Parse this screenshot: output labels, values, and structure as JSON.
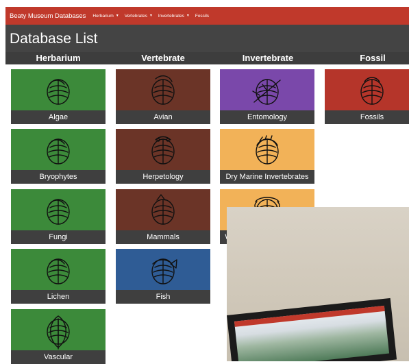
{
  "nav": {
    "brand": "Beaty Museum Databases",
    "items": [
      {
        "label": "Herbarium",
        "has_dropdown": true
      },
      {
        "label": "Vertebrates",
        "has_dropdown": true
      },
      {
        "label": "Invertebrates",
        "has_dropdown": true
      },
      {
        "label": "Fossils",
        "has_dropdown": false
      }
    ]
  },
  "page": {
    "title": "Database List"
  },
  "columns": [
    "Herbarium",
    "Vertebrate",
    "Invertebrate",
    "Fossil"
  ],
  "tiles": [
    {
      "label": "Algae",
      "column": "Herbarium",
      "color": "#3c8a3a",
      "icon": "leaf-on-turtle-icon"
    },
    {
      "label": "Bryophytes",
      "column": "Herbarium",
      "color": "#3c8a3a",
      "icon": "leaf-on-turtle-icon"
    },
    {
      "label": "Fungi",
      "column": "Herbarium",
      "color": "#3c8a3a",
      "icon": "leaf-on-turtle-icon"
    },
    {
      "label": "Lichen",
      "column": "Herbarium",
      "color": "#3c8a3a",
      "icon": "leaf-on-turtle-icon"
    },
    {
      "label": "Vascular",
      "column": "Herbarium",
      "color": "#3c8a3a",
      "icon": "leaf-icon"
    },
    {
      "label": "Avian",
      "column": "Vertebrate",
      "color": "#6b3427",
      "icon": "bird-icon"
    },
    {
      "label": "Herpetology",
      "column": "Vertebrate",
      "color": "#6b3427",
      "icon": "frog-icon"
    },
    {
      "label": "Mammals",
      "column": "Vertebrate",
      "color": "#6b3427",
      "icon": "mammal-icon"
    },
    {
      "label": "Fish",
      "column": "Vertebrate",
      "color": "#2f5c95",
      "icon": "fish-icon"
    },
    {
      "label": "Entomology",
      "column": "Invertebrate",
      "color": "#7a48aa",
      "icon": "insect-icon"
    },
    {
      "label": "Dry Marine Invertebrates",
      "column": "Invertebrate",
      "color": "#f2b258",
      "icon": "shell-icon"
    },
    {
      "label": "Wet Marine Invertebrates",
      "column": "Invertebrate",
      "color": "#f2b258",
      "icon": "octopus-icon"
    },
    {
      "label": "Fossils",
      "column": "Fossil",
      "color": "#b5352a",
      "icon": "trilobite-icon"
    }
  ]
}
